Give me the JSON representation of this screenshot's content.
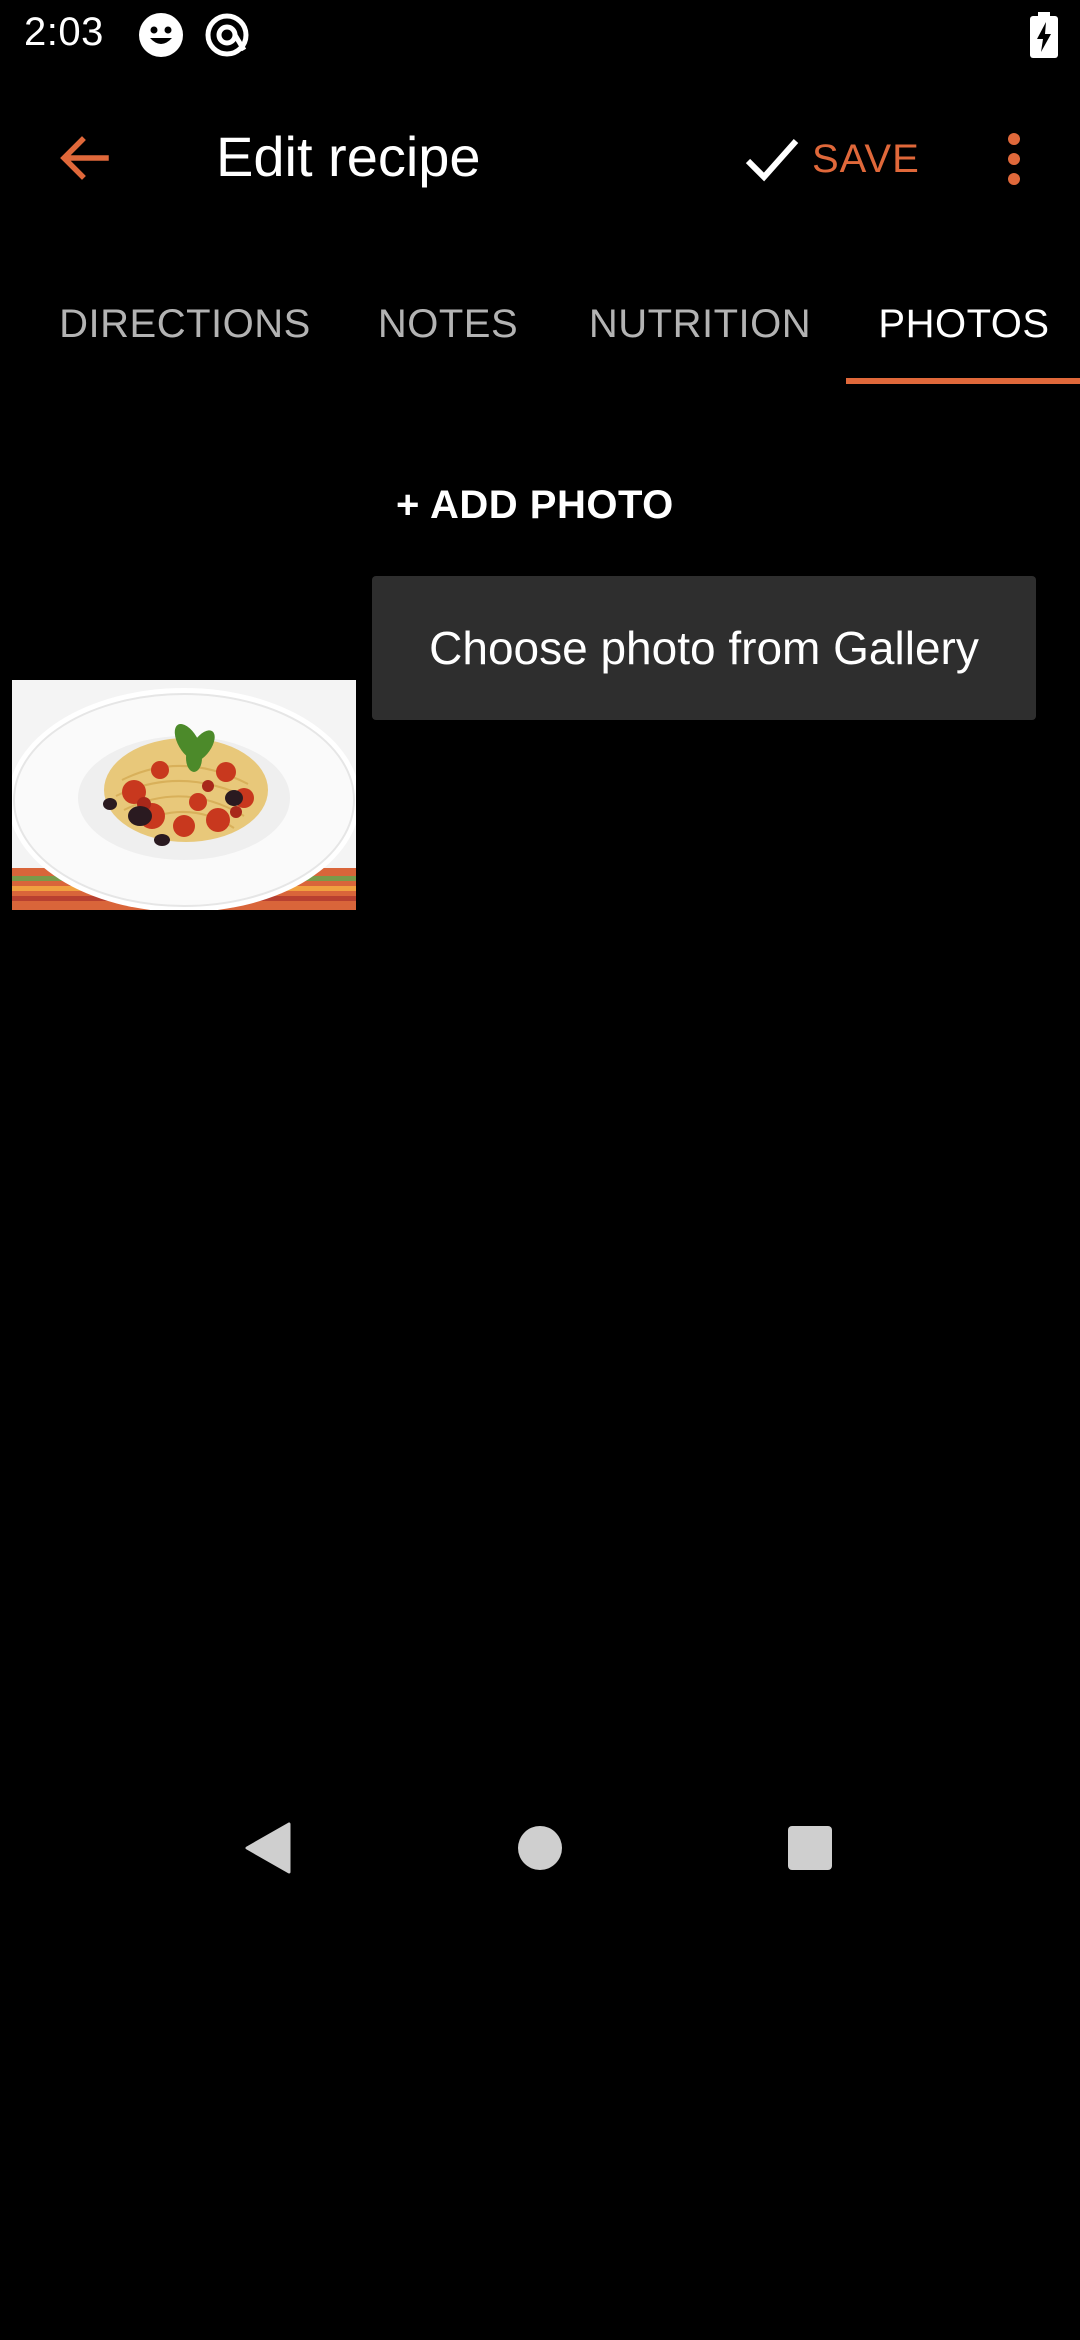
{
  "status_bar": {
    "time": "2:03",
    "icons": [
      "smiley-icon",
      "at-icon",
      "battery-charging-icon"
    ]
  },
  "toolbar": {
    "title": "Edit recipe",
    "save_label": "SAVE",
    "back_icon": "arrow-left-icon",
    "save_icon": "check-icon",
    "more_icon": "more-vert-icon"
  },
  "tabs": [
    {
      "label": "DIRECTIONS",
      "active": false
    },
    {
      "label": "NOTES",
      "active": false
    },
    {
      "label": "NUTRITION",
      "active": false
    },
    {
      "label": "PHOTOS",
      "active": true
    }
  ],
  "content": {
    "add_photo_label": "+ ADD PHOTO",
    "popup_menu": {
      "items": [
        "Choose photo from Gallery"
      ]
    },
    "photo": {
      "description_icon": "spaghetti-photo"
    }
  },
  "nav_bar": {
    "icons": [
      "nav-back-icon",
      "nav-home-icon",
      "nav-recents-icon"
    ]
  },
  "colors": {
    "accent": "#e0683a",
    "background": "#000000",
    "popup_background": "#2e2e2e",
    "inactive_tab": "#b3b3b3"
  }
}
